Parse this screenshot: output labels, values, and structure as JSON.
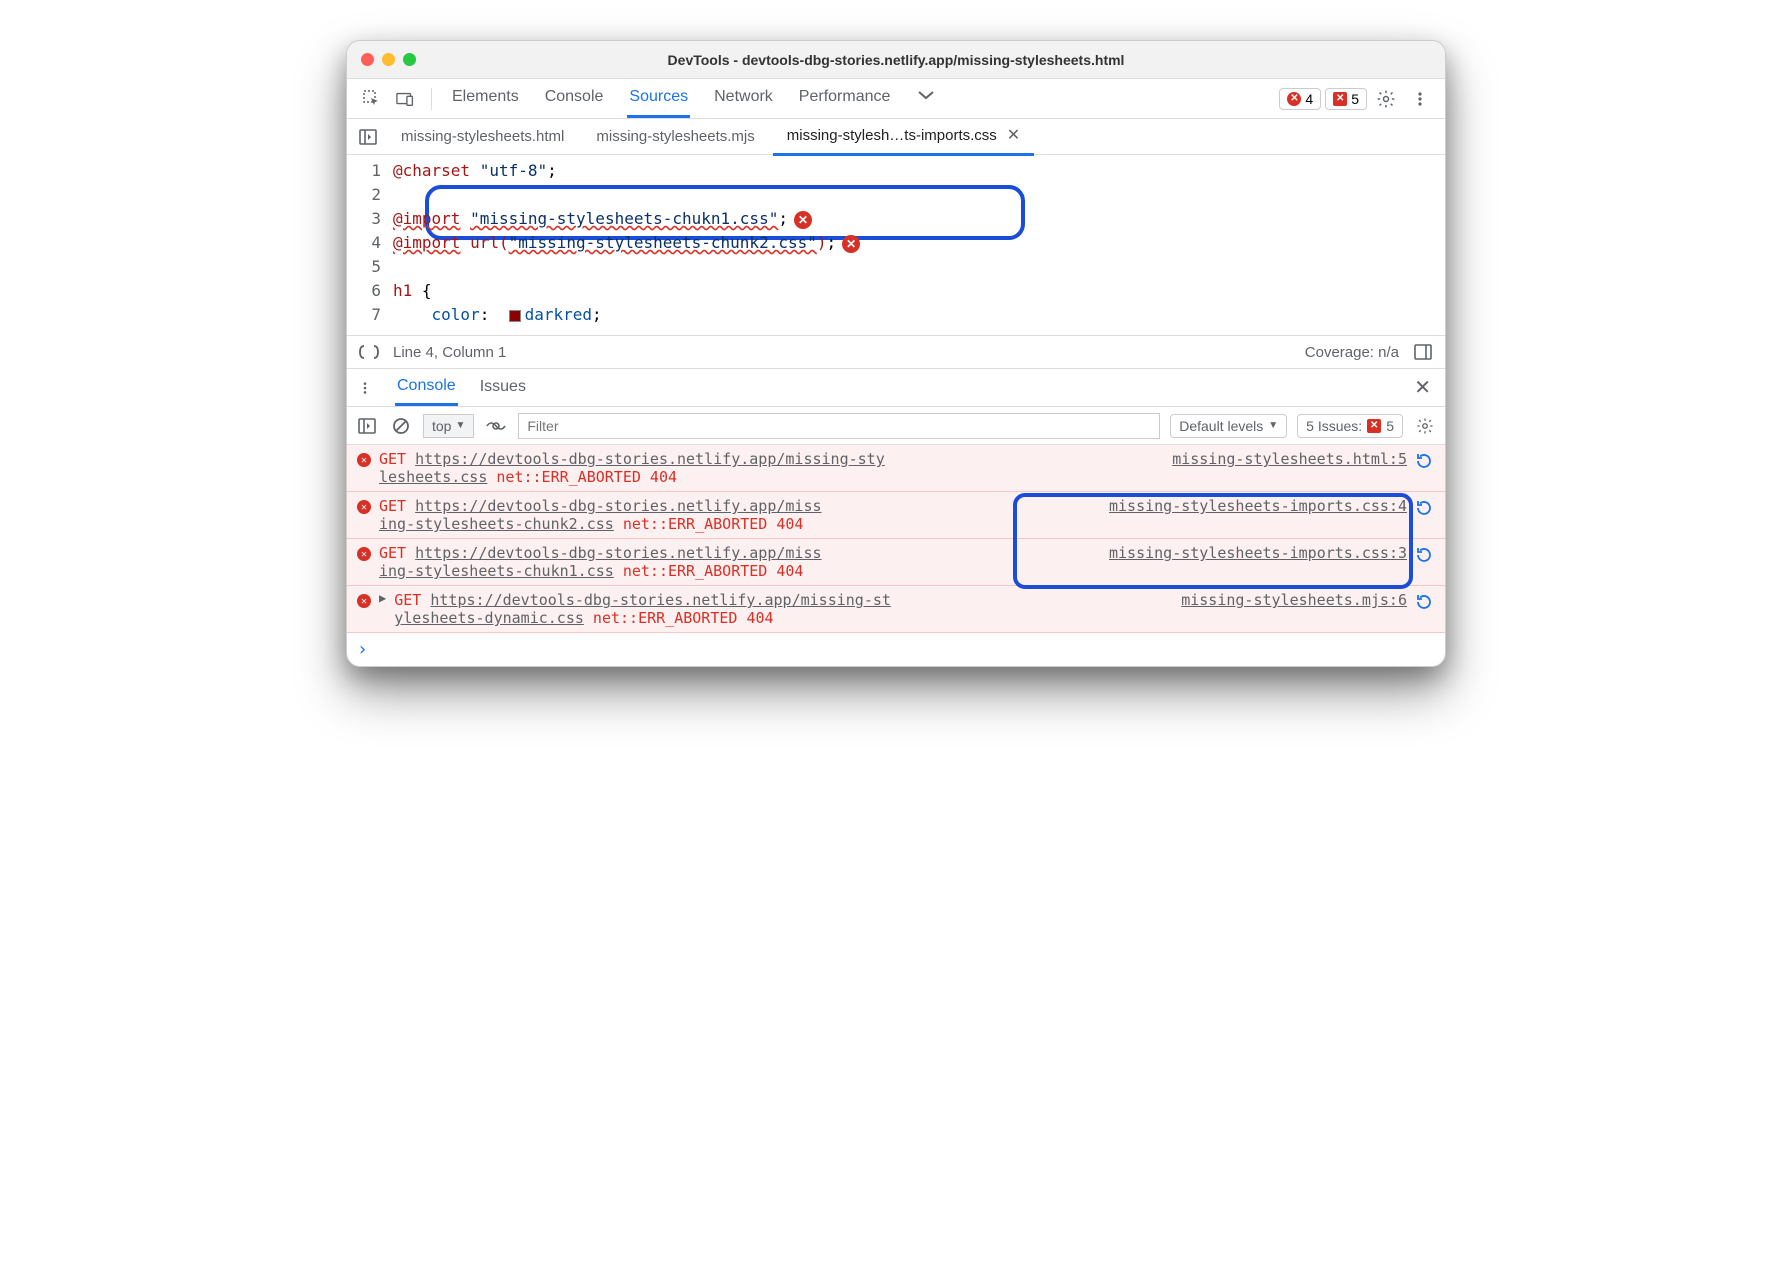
{
  "window": {
    "title": "DevTools - devtools-dbg-stories.netlify.app/missing-stylesheets.html"
  },
  "toolbar": {
    "tabs": [
      "Elements",
      "Console",
      "Sources",
      "Network",
      "Performance"
    ],
    "active_tab_index": 2,
    "more_tabs_label": "more-panels",
    "error_badge": "4",
    "issue_badge": "5"
  },
  "file_tabs": {
    "items": [
      {
        "label": "missing-stylesheets.html",
        "active": false,
        "closable": false
      },
      {
        "label": "missing-stylesheets.mjs",
        "active": false,
        "closable": false
      },
      {
        "label": "missing-stylesh…ts-imports.css",
        "active": true,
        "closable": true
      }
    ]
  },
  "source": {
    "lines": [
      {
        "n": 1,
        "charset_kw": "@charset",
        "charset_val": "\"utf-8\"",
        "tail": ";"
      },
      {
        "n": 2
      },
      {
        "n": 3,
        "import_kw": "@import",
        "import_val": "\"missing-stylesheets-chukn1.css\"",
        "tail": ";",
        "error": true
      },
      {
        "n": 4,
        "import_kw": "@import",
        "url_kw": "url(",
        "url_val": "\"missing-stylesheets-chunk2.css\"",
        "url_close": ")",
        "tail": ";",
        "error": true
      },
      {
        "n": 5
      },
      {
        "n": 6,
        "sel": "h1",
        "brace": " {"
      },
      {
        "n": 7,
        "indent": "    ",
        "prop": "color",
        "colon": ":  ",
        "color_name": "darkred",
        "tail": ";"
      }
    ]
  },
  "statusbar": {
    "cursor": "Line 4, Column 1",
    "coverage": "Coverage: n/a"
  },
  "drawer": {
    "tabs": [
      "Console",
      "Issues"
    ],
    "active_index": 0
  },
  "console_bar": {
    "context": "top",
    "filter_placeholder": "Filter",
    "levels": "Default levels",
    "issues_label": "5 Issues:",
    "issues_count": "5"
  },
  "messages": [
    {
      "method": "GET",
      "url_pre": "https://devtools-dbg-stories.netlify.app/missing-sty",
      "url_wrap": "lesheets.css",
      "err": "net::ERR_ABORTED 404",
      "source": "missing-stylesheets.html:5",
      "expand": false
    },
    {
      "method": "GET",
      "url_pre": "https://devtools-dbg-stories.netlify.app/miss",
      "url_wrap": "ing-stylesheets-chunk2.css",
      "err": "net::ERR_ABORTED 404",
      "source": "missing-stylesheets-imports.css:4",
      "expand": false,
      "highlight_src": true
    },
    {
      "method": "GET",
      "url_pre": "https://devtools-dbg-stories.netlify.app/miss",
      "url_wrap": "ing-stylesheets-chukn1.css",
      "err": "net::ERR_ABORTED 404",
      "source": "missing-stylesheets-imports.css:3",
      "expand": false,
      "highlight_src": true
    },
    {
      "method": "GET",
      "url_pre": "https://devtools-dbg-stories.netlify.app/missing-st",
      "url_wrap": "ylesheets-dynamic.css",
      "err": "net::ERR_ABORTED 404",
      "source": "missing-stylesheets.mjs:6",
      "expand": true
    }
  ]
}
